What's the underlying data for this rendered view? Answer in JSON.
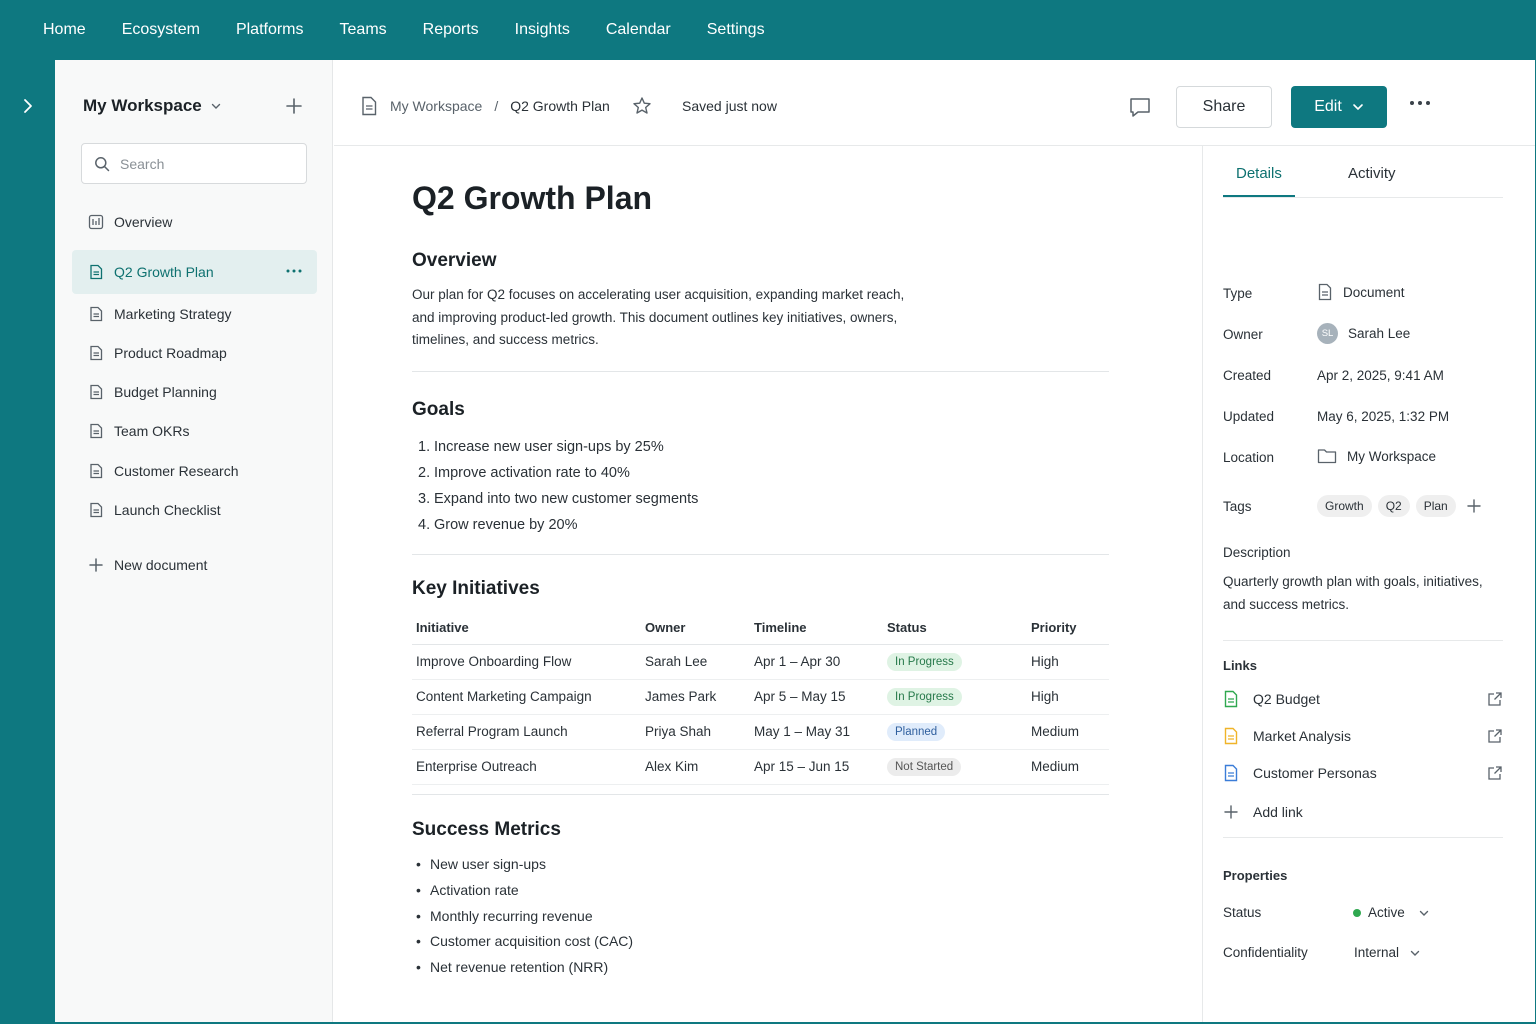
{
  "topnav": {
    "items": [
      "Home",
      "Ecosystem",
      "Platforms",
      "Teams",
      "Reports",
      "Insights",
      "Calendar",
      "Settings"
    ]
  },
  "rail": {
    "expand_icon": "chevron-right-icon"
  },
  "sidebar": {
    "workspace_title": "My Workspace",
    "search_placeholder": "Search",
    "items": [
      {
        "label": "Overview",
        "icon": "overview-icon"
      },
      {
        "label": "Q2 Growth Plan",
        "icon": "document-icon",
        "active": true
      },
      {
        "label": "Marketing Strategy",
        "icon": "document-icon"
      },
      {
        "label": "Product Roadmap",
        "icon": "document-icon"
      },
      {
        "label": "Budget Planning",
        "icon": "document-icon"
      },
      {
        "label": "Team OKRs",
        "icon": "document-icon"
      },
      {
        "label": "Customer Research",
        "icon": "document-icon"
      },
      {
        "label": "Launch Checklist",
        "icon": "document-icon"
      }
    ],
    "new_document_label": "New document"
  },
  "header": {
    "breadcrumb_root": "My Workspace",
    "breadcrumb_sep": "/",
    "breadcrumb_current": "Q2 Growth Plan",
    "saved_status": "Saved just now",
    "share_label": "Share",
    "edit_label": "Edit"
  },
  "document": {
    "title": "Q2 Growth Plan",
    "overview_heading": "Overview",
    "overview_text": "Our plan for Q2 focuses on accelerating user acquisition, expanding market reach, and improving product-led growth. This document outlines key initiatives, owners, timelines, and success metrics.",
    "goals_heading": "Goals",
    "goals": [
      "Increase new user sign-ups by 25%",
      "Improve activation rate to 40%",
      "Expand into two new customer segments",
      "Grow revenue by 20%"
    ],
    "initiatives_heading": "Key Initiatives",
    "table_headers": [
      "Initiative",
      "Owner",
      "Timeline",
      "Status",
      "Priority"
    ],
    "initiatives": [
      {
        "initiative": "Improve Onboarding Flow",
        "owner": "Sarah Lee",
        "timeline": "Apr 1 – Apr 30",
        "status": "In Progress",
        "status_kind": "progress",
        "priority": "High"
      },
      {
        "initiative": "Content Marketing Campaign",
        "owner": "James Park",
        "timeline": "Apr 5 – May 15",
        "status": "In Progress",
        "status_kind": "progress",
        "priority": "High"
      },
      {
        "initiative": "Referral Program Launch",
        "owner": "Priya Shah",
        "timeline": "May 1 – May 31",
        "status": "Planned",
        "status_kind": "planned",
        "priority": "Medium"
      },
      {
        "initiative": "Enterprise Outreach",
        "owner": "Alex Kim",
        "timeline": "Apr 15 – Jun 15",
        "status": "Not Started",
        "status_kind": "notstarted",
        "priority": "Medium"
      }
    ],
    "metrics_heading": "Success Metrics",
    "metrics": [
      "New user sign-ups",
      "Activation rate",
      "Monthly recurring revenue",
      "Customer acquisition cost (CAC)",
      "Net revenue retention (NRR)"
    ]
  },
  "panel": {
    "tabs": [
      "Details",
      "Activity"
    ],
    "labels": {
      "type": "Type",
      "owner": "Owner",
      "created": "Created",
      "updated": "Updated",
      "location": "Location",
      "tags": "Tags",
      "description": "Description",
      "links": "Links",
      "properties": "Properties",
      "status": "Status",
      "confidentiality": "Confidentiality"
    },
    "type_value": "Document",
    "owner_initials": "SL",
    "owner_name": "Sarah Lee",
    "created_value": "Apr 2, 2025, 9:41 AM",
    "updated_value": "May 6, 2025, 1:32 PM",
    "location_value": "My Workspace",
    "tags": [
      "Growth",
      "Q2",
      "Plan"
    ],
    "description_text": "Quarterly growth plan with goals, initiatives, and success metrics.",
    "links": [
      {
        "name": "Q2 Budget",
        "color": "#2fa84f"
      },
      {
        "name": "Market Analysis",
        "color": "#f0b429"
      },
      {
        "name": "Customer Personas",
        "color": "#3b7dd8"
      }
    ],
    "add_link_label": "Add link",
    "status_value": "Active",
    "confidentiality_value": "Internal"
  },
  "colors": {
    "brand": "#0e7880",
    "accent_text": "#0e7170"
  }
}
